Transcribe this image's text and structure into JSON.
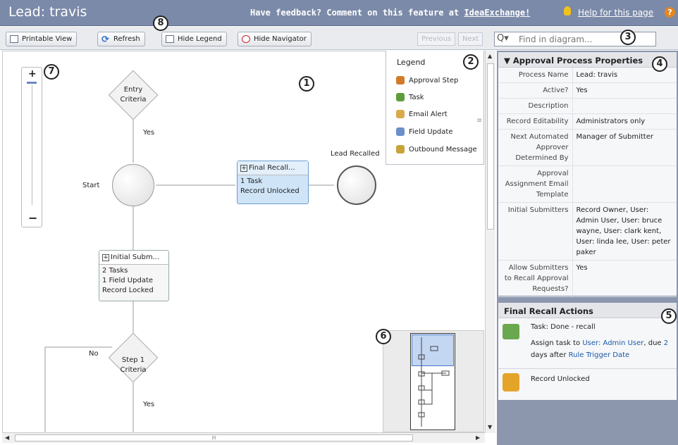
{
  "app": {
    "title": "Lead: travis",
    "feedback_prefix": "Have feedback? Comment on this feature at ",
    "feedback_link": "IdeaExchange!",
    "help": "Help for this page",
    "help_icon": "?"
  },
  "toolbar": {
    "printable": "Printable View",
    "refresh": "Refresh",
    "hide_legend": "Hide Legend",
    "hide_navigator": "Hide Navigator",
    "previous": "Previous",
    "next": "Next",
    "search_placeholder": "Find in diagram...",
    "search_icon": "Q▾"
  },
  "legend": {
    "title": "Legend",
    "items": [
      {
        "label": "Approval Step",
        "color": "#d17a2c"
      },
      {
        "label": "Task",
        "color": "#5c9c3a"
      },
      {
        "label": "Email Alert",
        "color": "#d9a94a"
      },
      {
        "label": "Field Update",
        "color": "#6b8fc9"
      },
      {
        "label": "Outbound Message",
        "color": "#c9a23a"
      }
    ]
  },
  "diagram": {
    "entry": "Entry Criteria",
    "entry_line1": "Entry",
    "entry_line2": "Criteria",
    "yes1": "Yes",
    "start": "Start",
    "final_recall_title": "Final Recall...",
    "final_recall_l1": "1 Task",
    "final_recall_l2": "Record Unlocked",
    "lead_recalled": "Lead Recalled",
    "initial_title": "Initial Subm...",
    "initial_l1": "2 Tasks",
    "initial_l2": "1 Field Update",
    "initial_l3": "Record Locked",
    "no": "No",
    "step1_line1": "Step 1",
    "step1_line2": "Criteria",
    "yes2": "Yes",
    "plus": "+"
  },
  "zoom": {
    "plus": "+",
    "minus": "−"
  },
  "scroll": {
    "hscroll_grip": "III",
    "vgrip": "≡"
  },
  "properties": {
    "title": "Approval Process Properties",
    "rows": [
      {
        "k": "Process Name",
        "v": "Lead: travis"
      },
      {
        "k": "Active?",
        "v": "Yes"
      },
      {
        "k": "Description",
        "v": ""
      },
      {
        "k": "Record Editability",
        "v": "Administrators only"
      },
      {
        "k": "Next Automated Approver Determined By",
        "v": "Manager of Submitter"
      },
      {
        "k": "Approval Assignment Email Template",
        "v": ""
      },
      {
        "k": "Initial Submitters",
        "v": "Record Owner, User: Admin User, User: bruce wayne, User: clark kent, User: linda lee, User: peter paker"
      },
      {
        "k": "Allow Submitters to Recall Approval Requests?",
        "v": "Yes"
      }
    ]
  },
  "recall": {
    "title": "Final Recall Actions",
    "task": "Task: Done - recall",
    "assign_pre": "Assign task to ",
    "assign_user": "User: Admin User",
    "assign_mid": ", due ",
    "assign_days": "2",
    "assign_mid2": " days after ",
    "assign_trigger": "Rule Trigger Date",
    "unlocked": "Record Unlocked"
  },
  "callouts": [
    "1",
    "2",
    "3",
    "4",
    "5",
    "6",
    "7",
    "8"
  ]
}
